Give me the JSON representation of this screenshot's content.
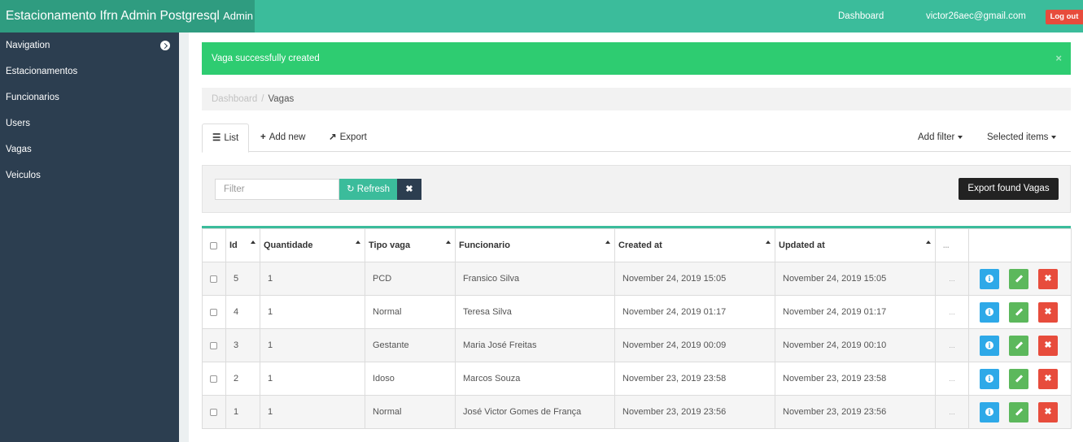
{
  "topbar": {
    "brand": "Estacionamento Ifrn Admin Postgresql",
    "brand_suffix": "Admin",
    "dashboard_link": "Dashboard",
    "user_email": "victor26aec@gmail.com",
    "logout": "Log out"
  },
  "sidebar": {
    "items": [
      {
        "label": "Navigation",
        "icon": "chevron-circle-right-icon"
      },
      {
        "label": "Estacionamentos"
      },
      {
        "label": "Funcionarios"
      },
      {
        "label": "Users"
      },
      {
        "label": "Vagas"
      },
      {
        "label": "Veiculos"
      }
    ]
  },
  "alert": {
    "message": "Vaga successfully created",
    "close": "×",
    "color": "#2ecc71"
  },
  "breadcrumb": {
    "root": "Dashboard",
    "separator": "/",
    "current": "Vagas"
  },
  "tabs": {
    "list": "List",
    "add_new": "Add new",
    "export": "Export",
    "add_filter": "Add filter",
    "selected_items": "Selected items"
  },
  "filter": {
    "placeholder": "Filter",
    "value": "",
    "refresh": "Refresh",
    "export_found": "Export found Vagas"
  },
  "table": {
    "columns": [
      "Id",
      "Quantidade",
      "Tipo vaga",
      "Funcionario",
      "Created at",
      "Updated at",
      "..."
    ],
    "rows": [
      {
        "id": "5",
        "quantidade": "1",
        "tipo": "PCD",
        "funcionario": "Fransico Silva",
        "created": "November 24, 2019 15:05",
        "updated": "November 24, 2019 15:05",
        "more": "..."
      },
      {
        "id": "4",
        "quantidade": "1",
        "tipo": "Normal",
        "funcionario": "Teresa Silva",
        "created": "November 24, 2019 01:17",
        "updated": "November 24, 2019 01:17",
        "more": "..."
      },
      {
        "id": "3",
        "quantidade": "1",
        "tipo": "Gestante",
        "funcionario": "Maria José Freitas",
        "created": "November 24, 2019 00:09",
        "updated": "November 24, 2019 00:10",
        "more": "..."
      },
      {
        "id": "2",
        "quantidade": "1",
        "tipo": "Idoso",
        "funcionario": "Marcos Souza",
        "created": "November 23, 2019 23:58",
        "updated": "November 23, 2019 23:58",
        "more": "..."
      },
      {
        "id": "1",
        "quantidade": "1",
        "tipo": "Normal",
        "funcionario": "José Victor Gomes de França",
        "created": "November 23, 2019 23:56",
        "updated": "November 23, 2019 23:56",
        "more": "..."
      }
    ]
  },
  "colors": {
    "accent": "#3bbc9b",
    "sidebar": "#2c3e50",
    "info": "#2ea9e8",
    "edit": "#5cb85c",
    "delete": "#e74c3c"
  }
}
